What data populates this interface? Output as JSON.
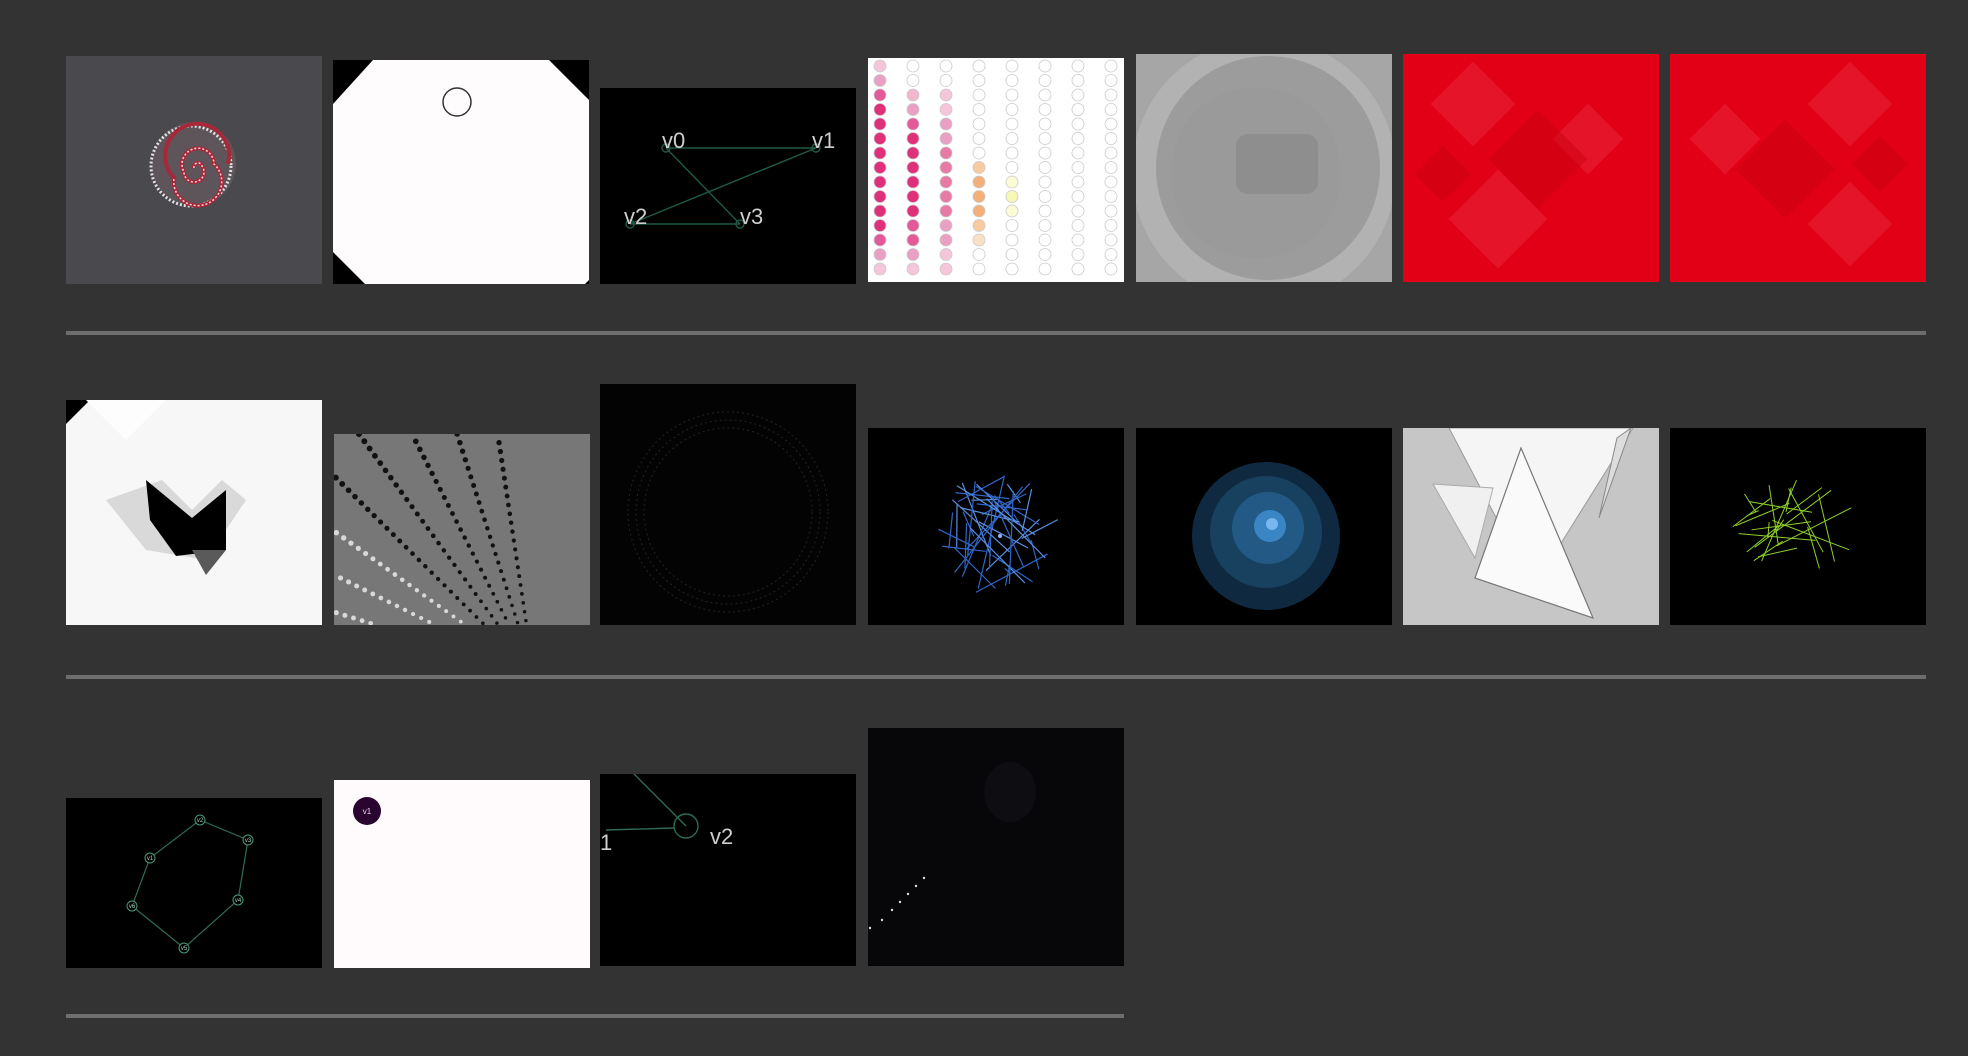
{
  "gallery": {
    "rows": [
      {
        "thumbnails": [
          {
            "name": "spiral-sketch"
          },
          {
            "name": "white-octagon-sketch"
          },
          {
            "name": "graph-four-vertices-sketch",
            "labels": [
              "v0",
              "v1",
              "v2",
              "v3"
            ]
          },
          {
            "name": "dot-matrix-sketch"
          },
          {
            "name": "gray-rings-sketch"
          },
          {
            "name": "red-diamonds-sketch-a"
          },
          {
            "name": "red-diamonds-sketch-b"
          }
        ]
      },
      {
        "thumbnails": [
          {
            "name": "black-white-shapes-sketch"
          },
          {
            "name": "dotted-rays-sketch"
          },
          {
            "name": "dark-circles-sketch"
          },
          {
            "name": "blue-line-ball-sketch"
          },
          {
            "name": "blue-orb-sketch"
          },
          {
            "name": "white-triangles-sketch"
          },
          {
            "name": "green-lines-sketch"
          }
        ]
      },
      {
        "thumbnails": [
          {
            "name": "hexagon-graph-sketch",
            "labels": [
              "v2",
              "v3",
              "v1",
              "v4",
              "v6",
              "v5"
            ]
          },
          {
            "name": "single-node-sketch",
            "labels": [
              "v1"
            ]
          },
          {
            "name": "graph-edge-sketch",
            "labels": [
              "1",
              "v2"
            ]
          },
          {
            "name": "dark-dots-sketch"
          }
        ]
      }
    ]
  },
  "colors": {
    "background": "#333333",
    "divider": "#6e6e6e",
    "red": "#e10016",
    "pink": "#e0307a",
    "blue": "#2f66c8",
    "green": "#8fd12a"
  }
}
